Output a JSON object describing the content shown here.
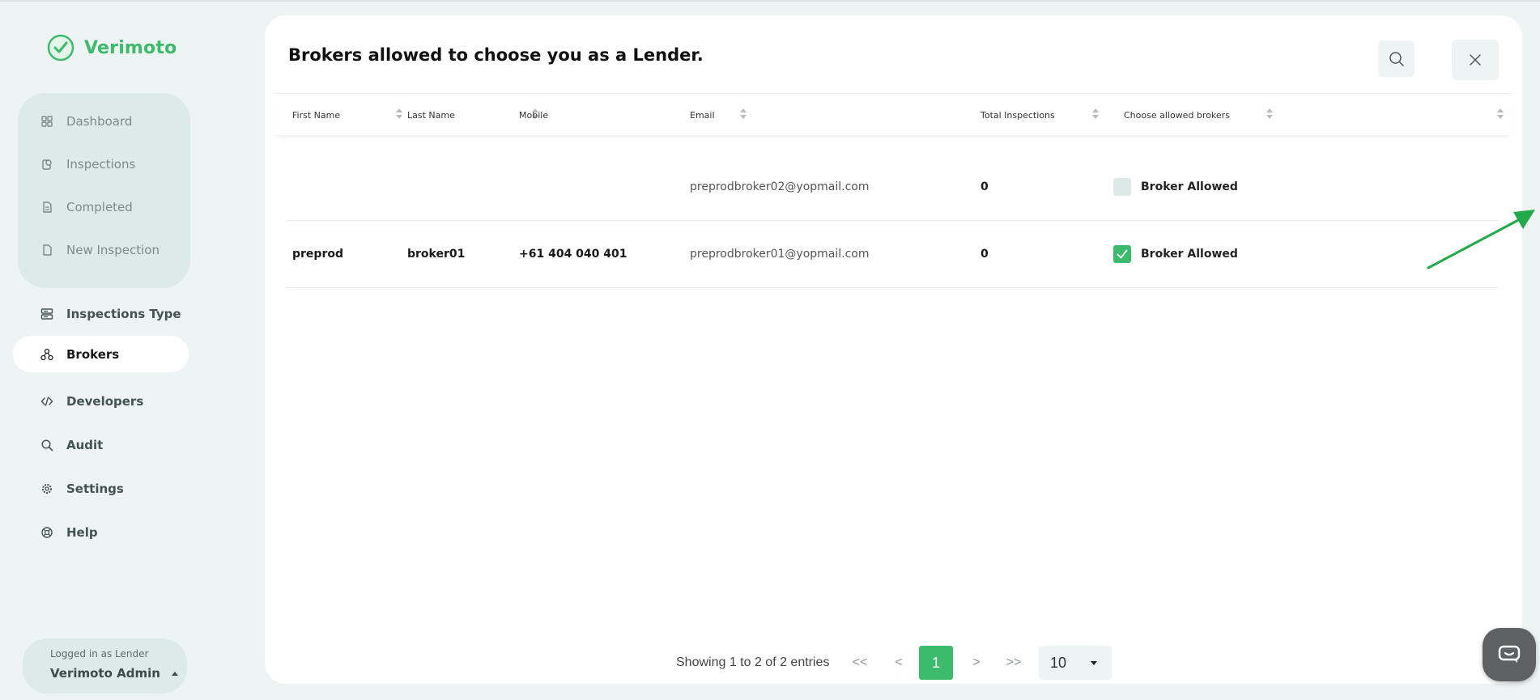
{
  "app": {
    "brand": "Verimoto",
    "accent": "#3dbb6c"
  },
  "sidebar": {
    "group_items": [
      {
        "label": "Dashboard",
        "icon": "dashboard-icon"
      },
      {
        "label": "Inspections",
        "icon": "inspections-icon"
      },
      {
        "label": "Completed",
        "icon": "completed-icon"
      },
      {
        "label": "New Inspection",
        "icon": "new-inspection-icon"
      }
    ],
    "main_items": [
      {
        "label": "Inspections Type",
        "icon": "inspections-type-icon"
      },
      {
        "label": "Brokers",
        "icon": "brokers-icon",
        "active": true
      },
      {
        "label": "Developers",
        "icon": "code-icon"
      },
      {
        "label": "Audit",
        "icon": "search-icon"
      },
      {
        "label": "Settings",
        "icon": "gear-icon"
      },
      {
        "label": "Help",
        "icon": "help-icon"
      }
    ],
    "user": {
      "role": "Logged in as Lender",
      "name": "Verimoto Admin"
    }
  },
  "main": {
    "title": "Brokers allowed to choose you as a Lender.",
    "columns": [
      "First Name",
      "Last Name",
      "Mobile",
      "Email",
      "Total Inspections",
      "Choose allowed brokers"
    ],
    "rows": [
      {
        "first_name": "",
        "last_name": "",
        "mobile": "",
        "email": "preprodbroker02@yopmail.com",
        "total_inspections": "0",
        "allowed": false,
        "allowed_label": "Broker Allowed"
      },
      {
        "first_name": "preprod",
        "last_name": "broker01",
        "mobile": "+61 404 040 401",
        "email": "preprodbroker01@yopmail.com",
        "total_inspections": "0",
        "allowed": true,
        "allowed_label": "Broker Allowed"
      }
    ],
    "pagination": {
      "summary": "Showing 1 to 2 of 2 entries",
      "first": "<<",
      "prev": "<",
      "current": "1",
      "next": ">",
      "last": ">>",
      "page_size": "10"
    }
  }
}
